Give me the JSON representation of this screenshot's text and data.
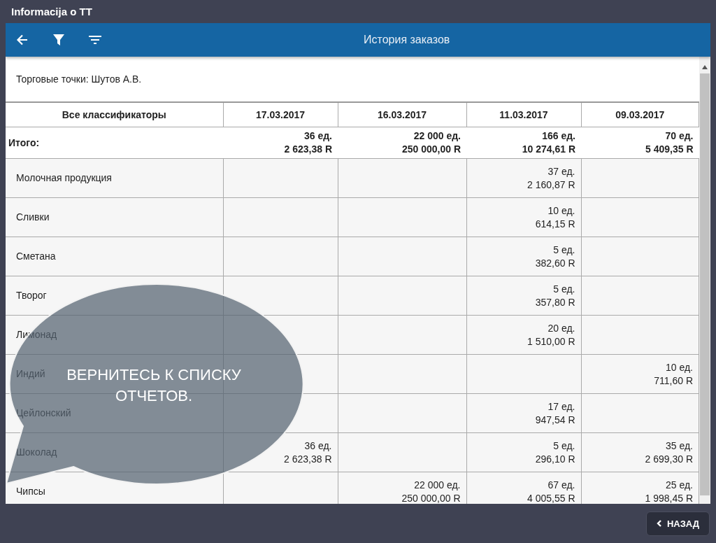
{
  "window": {
    "title": "Informacija o TT"
  },
  "toolbar": {
    "title": "История заказов"
  },
  "filter_label": "Торговые точки: Шутов А.В.",
  "table": {
    "columns": [
      "Все классификаторы",
      "17.03.2017",
      "16.03.2017",
      "11.03.2017",
      "09.03.2017"
    ],
    "total": {
      "cells": [
        "Итого:",
        "36 ед.\n2 623,38 R",
        "22 000 ед.\n250 000,00 R",
        "166 ед.\n10 274,61 R",
        "70 ед.\n5 409,35 R"
      ]
    },
    "rows": [
      {
        "cells": [
          "Молочная продукция",
          "",
          "",
          "37 ед.\n2 160,87 R",
          ""
        ]
      },
      {
        "cells": [
          "Сливки",
          "",
          "",
          "10 ед.\n614,15 R",
          ""
        ]
      },
      {
        "cells": [
          "Сметана",
          "",
          "",
          "5 ед.\n382,60 R",
          ""
        ]
      },
      {
        "cells": [
          "Творог",
          "",
          "",
          "5 ед.\n357,80 R",
          ""
        ]
      },
      {
        "cells": [
          "Лимонад",
          "",
          "",
          "20 ед.\n1 510,00 R",
          ""
        ]
      },
      {
        "cells": [
          "Индий",
          "",
          "",
          "",
          "10 ед.\n711,60 R"
        ]
      },
      {
        "cells": [
          "Цейлонский",
          "",
          "",
          "17 ед.\n947,54 R",
          ""
        ]
      },
      {
        "cells": [
          "Шоколад",
          "36 ед.\n2 623,38 R",
          "",
          "5 ед.\n296,10 R",
          "35 ед.\n2 699,30 R"
        ]
      },
      {
        "cells": [
          "Чипсы",
          "",
          "22 000 ед.\n250 000,00 R",
          "67 ед.\n4 005,55 R",
          "25 ед.\n1 998,45 R"
        ]
      }
    ]
  },
  "callout": {
    "text": "ВЕРНИТЕСЬ К СПИСКУ ОТЧЕТОВ."
  },
  "footer": {
    "back_button": "НАЗАД"
  }
}
